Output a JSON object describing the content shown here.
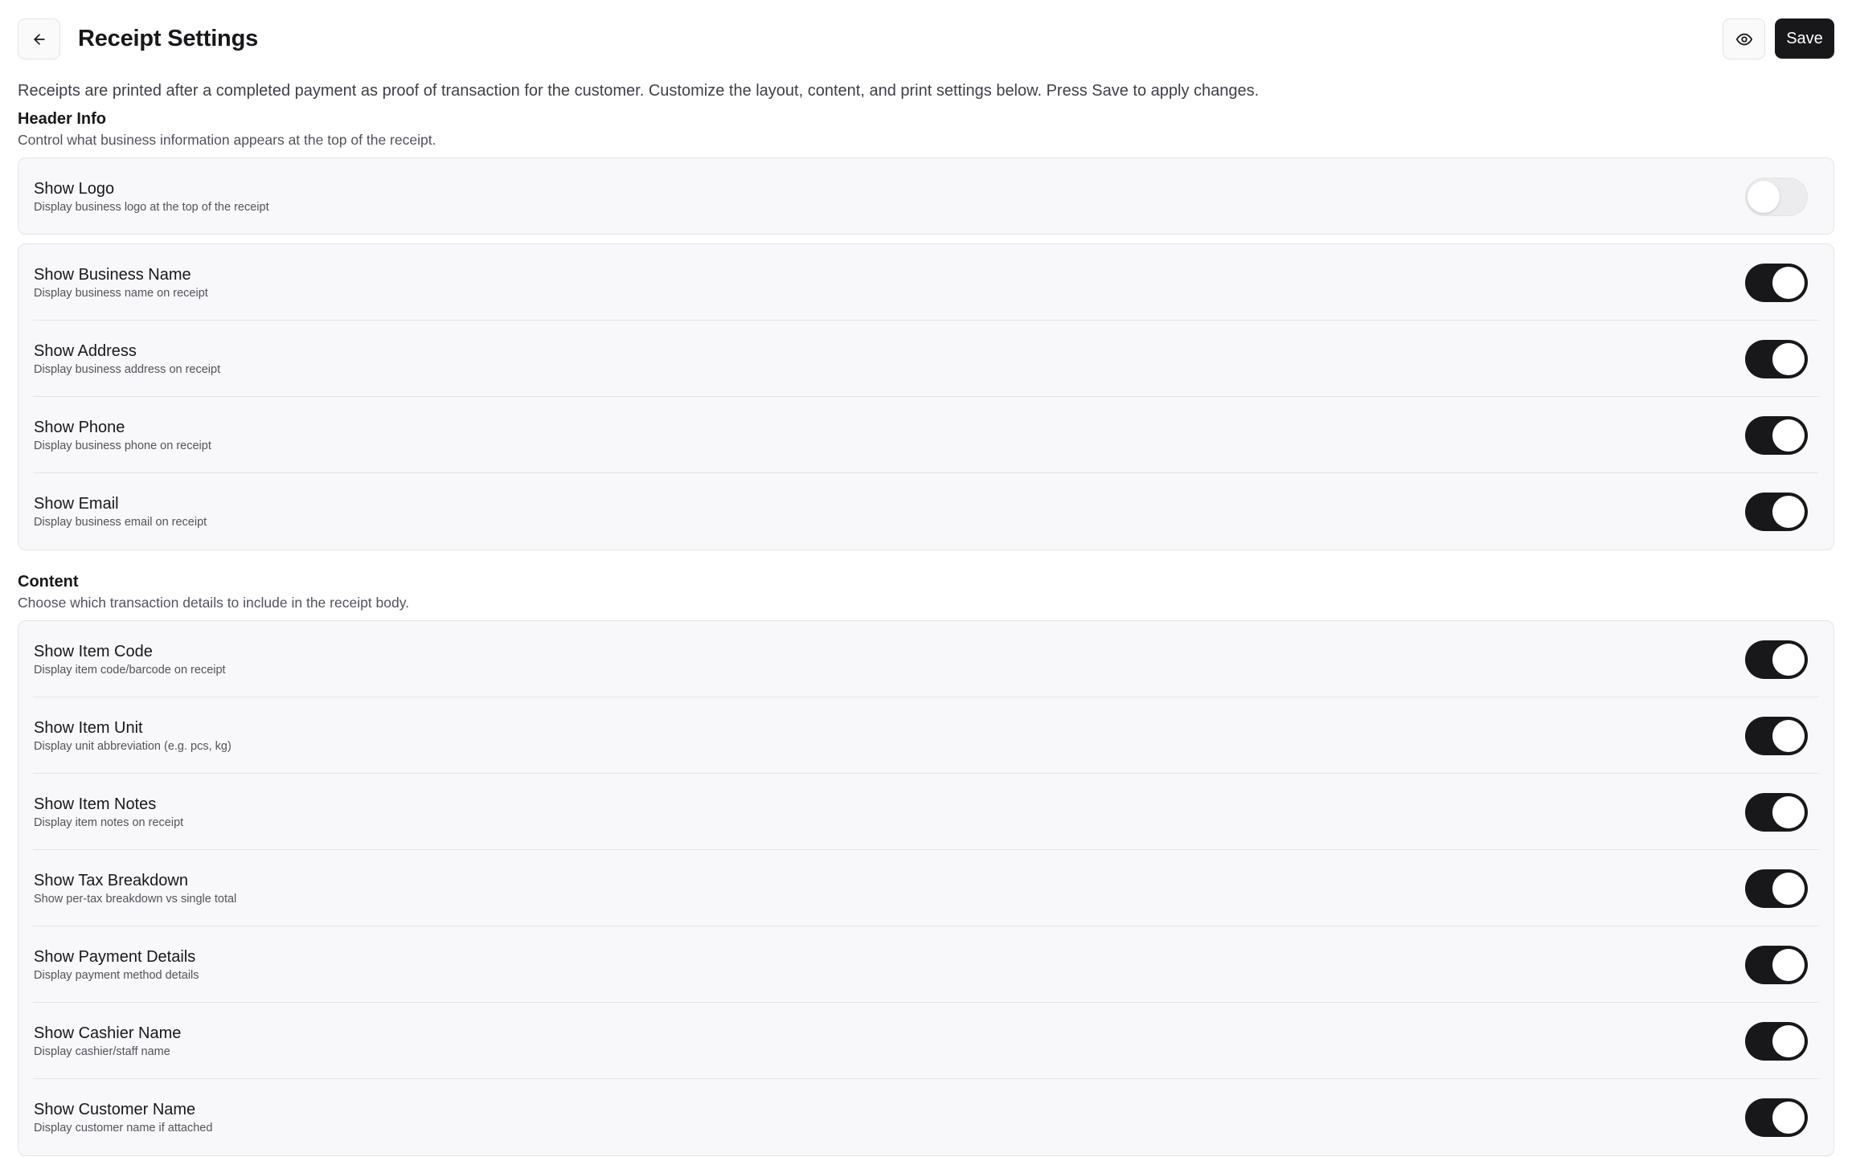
{
  "header": {
    "title": "Receipt Settings",
    "back_icon": "arrow-left-icon",
    "preview_icon": "eye-icon",
    "save_label": "Save"
  },
  "intro": "Receipts are printed after a completed payment as proof of transaction for the customer. Customize the layout, content, and print settings below. Press Save to apply changes.",
  "header_info": {
    "title": "Header Info",
    "description": "Control what business information appears at the top of the receipt.",
    "logo": {
      "label": "Show Logo",
      "description": "Display business logo at the top of the receipt",
      "enabled": false
    },
    "items": [
      {
        "label": "Show Business Name",
        "description": "Display business name on receipt",
        "enabled": true
      },
      {
        "label": "Show Address",
        "description": "Display business address on receipt",
        "enabled": true
      },
      {
        "label": "Show Phone",
        "description": "Display business phone on receipt",
        "enabled": true
      },
      {
        "label": "Show Email",
        "description": "Display business email on receipt",
        "enabled": true
      }
    ]
  },
  "content": {
    "title": "Content",
    "description": "Choose which transaction details to include in the receipt body.",
    "items": [
      {
        "label": "Show Item Code",
        "description": "Display item code/barcode on receipt",
        "enabled": true
      },
      {
        "label": "Show Item Unit",
        "description": "Display unit abbreviation (e.g. pcs, kg)",
        "enabled": true
      },
      {
        "label": "Show Item Notes",
        "description": "Display item notes on receipt",
        "enabled": true
      },
      {
        "label": "Show Tax Breakdown",
        "description": "Show per-tax breakdown vs single total",
        "enabled": true
      },
      {
        "label": "Show Payment Details",
        "description": "Display payment method details",
        "enabled": true
      },
      {
        "label": "Show Cashier Name",
        "description": "Display cashier/staff name",
        "enabled": true
      },
      {
        "label": "Show Customer Name",
        "description": "Display customer name if attached",
        "enabled": true
      }
    ]
  },
  "colors": {
    "primary": "#18181b",
    "card_bg": "#f8f8fa",
    "border": "#e4e4e7",
    "toggle_off": "#ececee"
  }
}
